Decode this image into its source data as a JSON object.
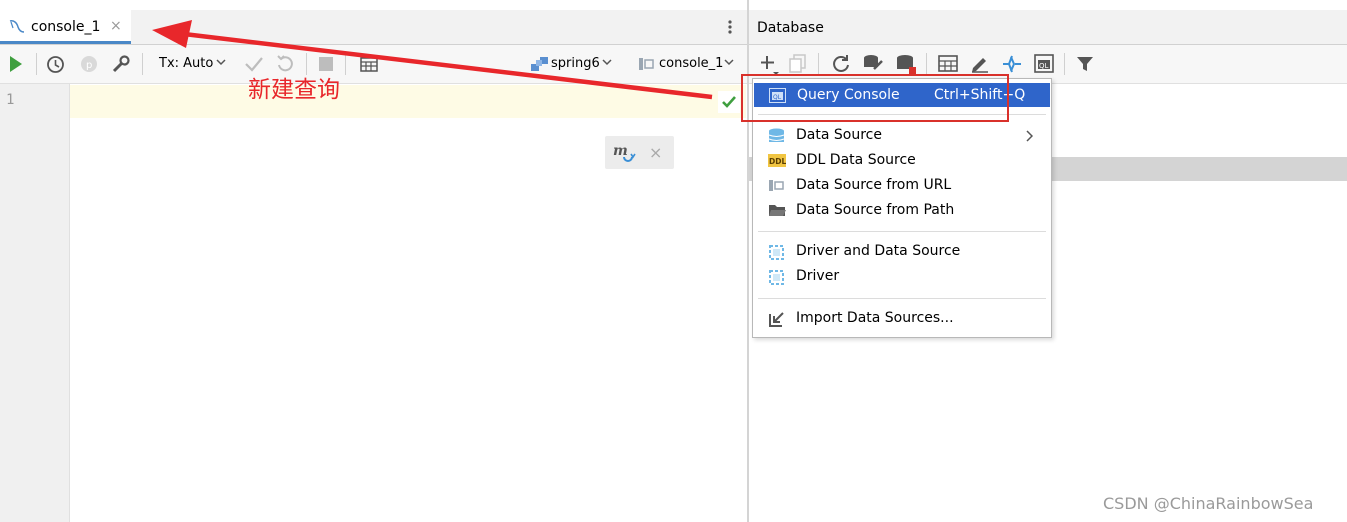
{
  "editor": {
    "tab_label": "console_1",
    "tab_close": "×",
    "line_number": "1",
    "tx_label": "Tx: Auto",
    "datasource_label": "spring6",
    "session_label": "console_1"
  },
  "annotation": {
    "text": "新建查询",
    "color": "#e8272b"
  },
  "database_panel": {
    "title": "Database"
  },
  "menu": {
    "items": [
      {
        "label": "Query Console",
        "shortcut": "Ctrl+Shift+Q",
        "icon": "query-console-icon",
        "selected": true
      },
      {
        "label": "Data Source",
        "icon": "data-source-icon",
        "submenu": true
      },
      {
        "label": "DDL Data Source",
        "icon": "ddl-icon"
      },
      {
        "label": "Data Source from URL",
        "icon": "url-icon"
      },
      {
        "label": "Data Source from Path",
        "icon": "folder-icon"
      },
      {
        "label": "Driver and Data Source",
        "icon": "driver-ds-icon"
      },
      {
        "label": "Driver",
        "icon": "driver-icon"
      },
      {
        "label": "Import Data Sources...",
        "icon": "import-icon"
      }
    ]
  },
  "watermark": "CSDN @ChinaRainbowSea",
  "colors": {
    "accent": "#2f65ca",
    "run_green": "#3f9f3f",
    "tab_underline": "#4a88c7"
  }
}
